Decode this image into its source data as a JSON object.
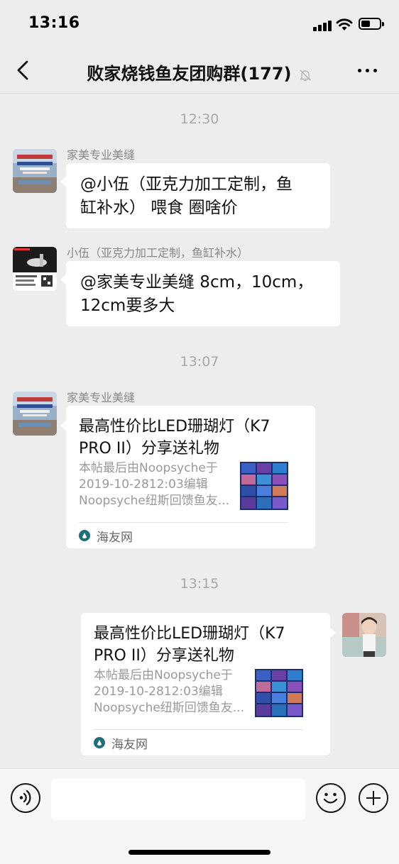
{
  "status_bar": {
    "time": "13:16"
  },
  "nav": {
    "title": "败家烧钱鱼友团购群(177)",
    "muted": true
  },
  "messages": [
    {
      "type": "timestamp",
      "text": "12:30"
    },
    {
      "type": "text",
      "side": "left",
      "sender": "家美专业美缝",
      "lines": [
        "@小伍（亚克力加工定制，鱼",
        "缸补水） 喂食 圈啥价"
      ]
    },
    {
      "type": "text",
      "side": "left",
      "sender": "小伍（亚克力加工定制，鱼缸补水）",
      "lines": [
        "@家美专业美缝 8cm，10cm，",
        "12cm要多大"
      ]
    },
    {
      "type": "timestamp",
      "text": "13:07"
    },
    {
      "type": "link_card",
      "side": "left",
      "sender": "家美专业美缝",
      "title_lines": [
        "最高性价比LED珊瑚灯（K7",
        "PRO II）分享送礼物"
      ],
      "desc_lines": [
        "本帖最后由Noopsyche于",
        "2019-10-2812:03编辑",
        "Noopsyche纽斯回馈鱼友..."
      ],
      "source": "海友网"
    },
    {
      "type": "timestamp",
      "text": "13:15"
    },
    {
      "type": "link_card",
      "side": "right",
      "title_lines": [
        "最高性价比LED珊瑚灯（K7",
        "PRO II）分享送礼物"
      ],
      "desc_lines": [
        "本帖最后由Noopsyche于",
        "2019-10-2812:03编辑",
        "Noopsyche纽斯回馈鱼友..."
      ],
      "source": "海友网"
    }
  ],
  "input_bar": {
    "value": "",
    "placeholder": ""
  },
  "icons": {
    "back": "chevron-left-icon",
    "mute": "bell-slash-icon",
    "more": "more-dots-icon",
    "voice": "voice-icon",
    "emoji": "emoji-icon",
    "plus": "plus-icon"
  },
  "colors": {
    "background": "#ededed",
    "bubble": "#ffffff",
    "timestamp": "#a8a8a8",
    "sender": "#888888",
    "card_desc": "#999999",
    "source_icon": "#1d6f7a"
  }
}
